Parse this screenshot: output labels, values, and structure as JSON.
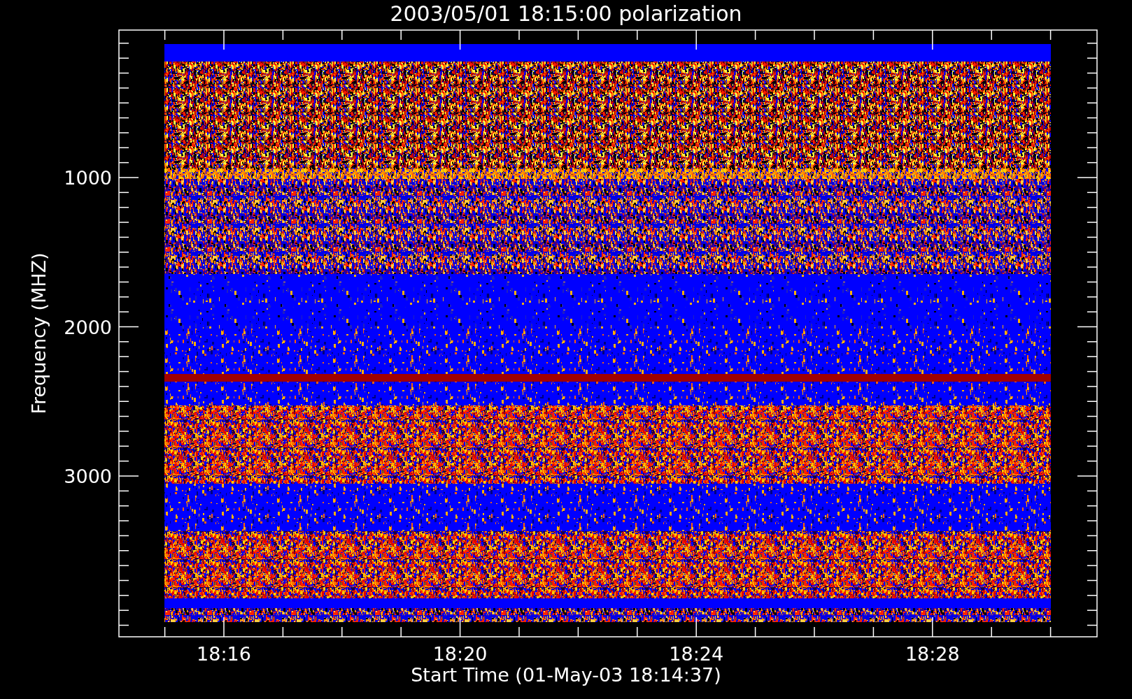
{
  "title": "2003/05/01 18:15:00 polarization",
  "y_axis": {
    "label": "Frequency (MHZ)",
    "ticks": [
      "1000",
      "2000",
      "3000"
    ]
  },
  "x_axis": {
    "label": "Start Time (01-May-03 18:14:37)",
    "ticks": [
      "18:16",
      "18:20",
      "18:24",
      "18:28"
    ]
  }
}
